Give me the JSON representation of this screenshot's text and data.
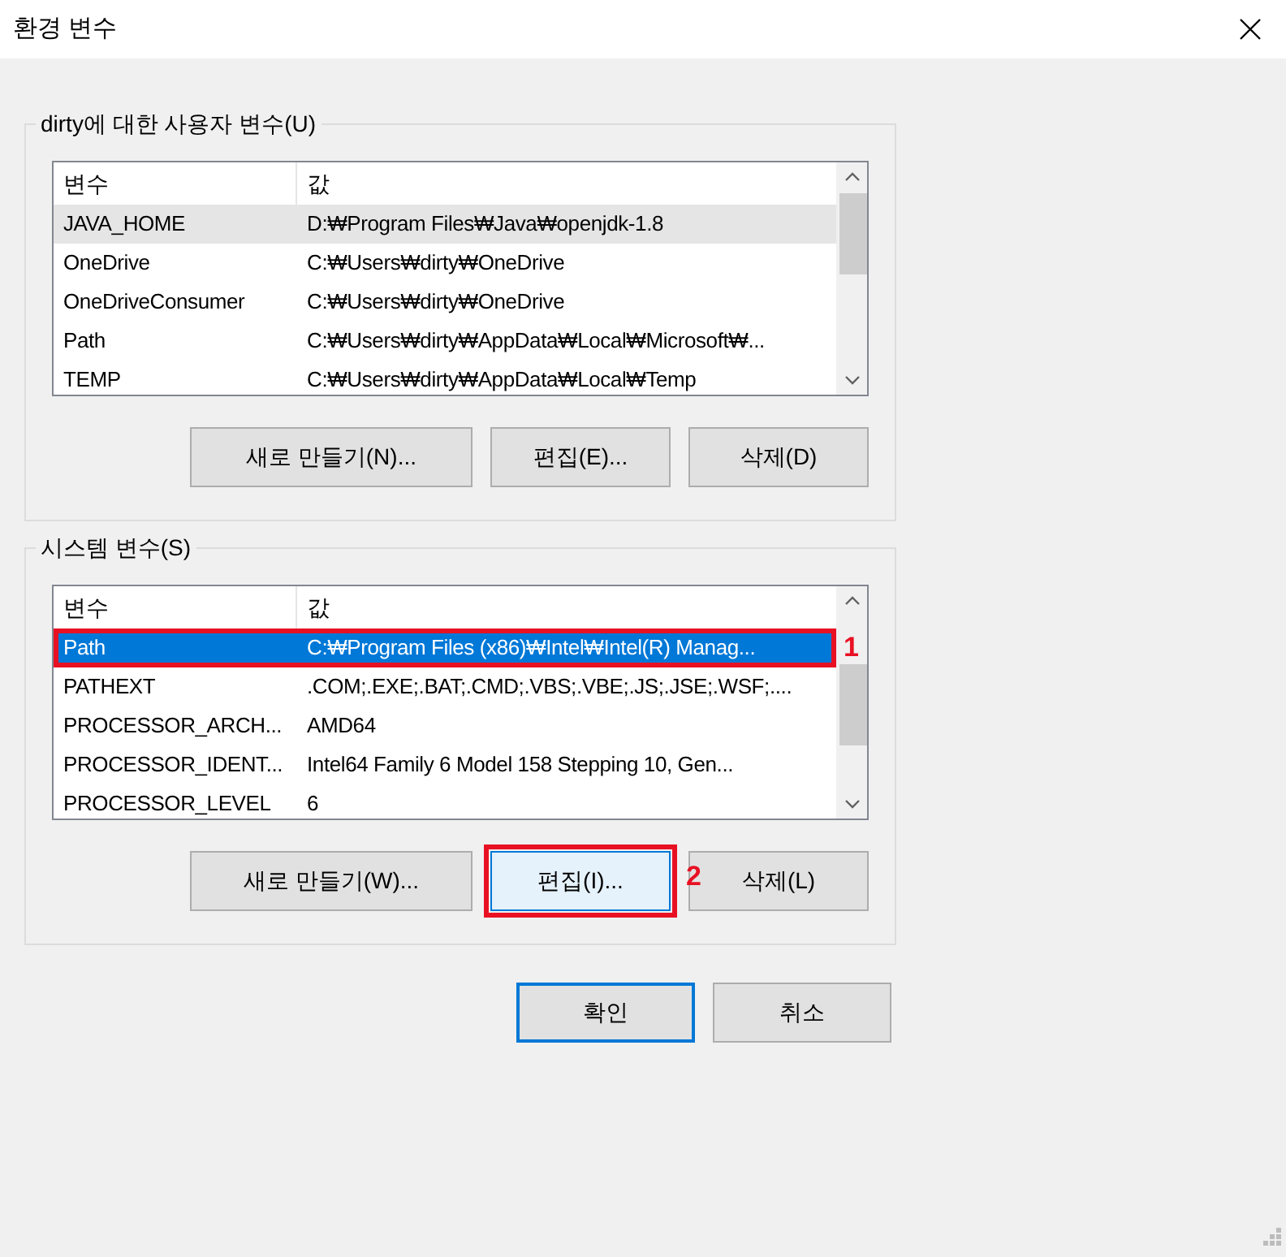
{
  "window": {
    "title": "환경 변수"
  },
  "groups": [
    {
      "legend": "dirty에 대한 사용자 변수(U)",
      "columns": [
        "변수",
        "값"
      ],
      "rows": [
        {
          "name": "JAVA_HOME",
          "value": "D:₩Program Files₩Java₩openjdk-1.8",
          "selected": false,
          "highlighted": true
        },
        {
          "name": "OneDrive",
          "value": "C:₩Users₩dirty₩OneDrive",
          "selected": false,
          "highlighted": false
        },
        {
          "name": "OneDriveConsumer",
          "value": "C:₩Users₩dirty₩OneDrive",
          "selected": false,
          "highlighted": false
        },
        {
          "name": "Path",
          "value": "C:₩Users₩dirty₩AppData₩Local₩Microsoft₩...",
          "selected": false,
          "highlighted": false
        },
        {
          "name": "TEMP",
          "value": "C:₩Users₩dirty₩AppData₩Local₩Temp",
          "selected": false,
          "highlighted": false
        }
      ],
      "buttons": [
        {
          "label": "새로 만들기(N)...",
          "hovered": false
        },
        {
          "label": "편집(E)...",
          "hovered": false
        },
        {
          "label": "삭제(D)",
          "hovered": false
        }
      ]
    },
    {
      "legend": "시스템 변수(S)",
      "columns": [
        "변수",
        "값"
      ],
      "rows": [
        {
          "name": "Path",
          "value": "C:₩Program Files (x86)₩Intel₩Intel(R) Manag...",
          "selected": true,
          "highlighted": false,
          "annotation": "1"
        },
        {
          "name": "PATHEXT",
          "value": ".COM;.EXE;.BAT;.CMD;.VBS;.VBE;.JS;.JSE;.WSF;....",
          "selected": false,
          "highlighted": false
        },
        {
          "name": "PROCESSOR_ARCH...",
          "value": "AMD64",
          "selected": false,
          "highlighted": false
        },
        {
          "name": "PROCESSOR_IDENT...",
          "value": "Intel64 Family 6 Model 158 Stepping 10, Gen...",
          "selected": false,
          "highlighted": false
        },
        {
          "name": "PROCESSOR_LEVEL",
          "value": "6",
          "selected": false,
          "highlighted": false
        }
      ],
      "buttons": [
        {
          "label": "새로 만들기(W)...",
          "hovered": false
        },
        {
          "label": "편집(I)...",
          "hovered": true,
          "annotation": "2"
        },
        {
          "label": "삭제(L)",
          "hovered": false
        }
      ]
    }
  ],
  "footer_buttons": [
    {
      "label": "확인",
      "default": true
    },
    {
      "label": "취소",
      "default": false
    }
  ]
}
